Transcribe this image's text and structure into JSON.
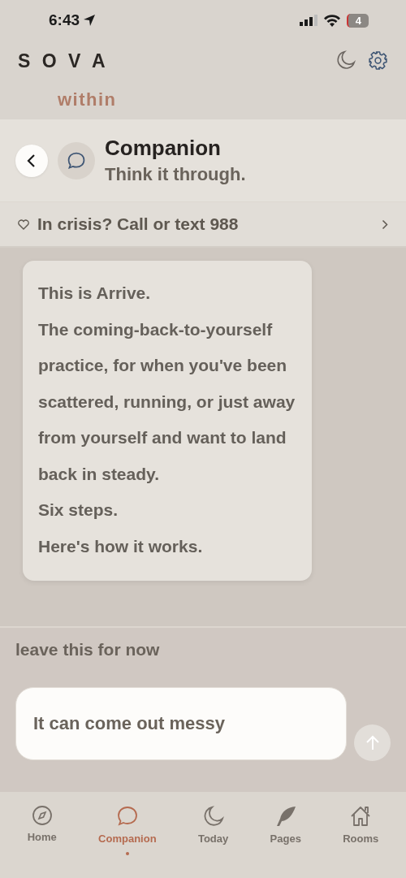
{
  "status_bar": {
    "time": "6:43",
    "battery": "4"
  },
  "brand": {
    "name": "S O V A",
    "tagline": "within"
  },
  "header": {
    "title": "Companion",
    "subtitle": "Think it through."
  },
  "crisis_banner": {
    "text": "In crisis? Call or text 988"
  },
  "message": {
    "paragraphs": [
      "This is Arrive.",
      "The coming-back-to-yourself practice, for when you've been scattered, running, or just away from yourself and want to land back in steady.",
      "Six steps.",
      "Here's how it works."
    ]
  },
  "leave_link": "leave this for now",
  "composer": {
    "placeholder": "It can come out messy"
  },
  "tabs": [
    {
      "label": "Home",
      "selected": false
    },
    {
      "label": "Companion",
      "selected": true
    },
    {
      "label": "Today",
      "selected": false
    },
    {
      "label": "Pages",
      "selected": false
    },
    {
      "label": "Rooms",
      "selected": false
    }
  ]
}
